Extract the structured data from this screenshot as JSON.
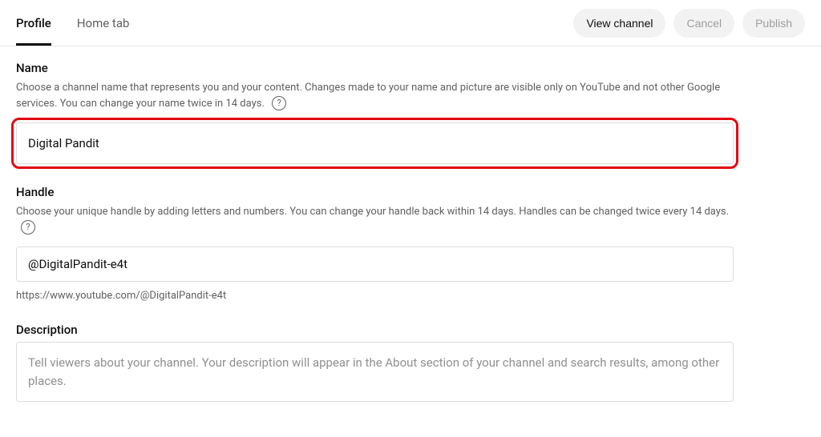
{
  "tabs": {
    "profile": "Profile",
    "home": "Home tab"
  },
  "actions": {
    "view": "View channel",
    "cancel": "Cancel",
    "publish": "Publish"
  },
  "name": {
    "title": "Name",
    "desc": "Choose a channel name that represents you and your content. Changes made to your name and picture are visible only on YouTube and not other Google services. You can change your name twice in 14 days.",
    "value": "Digital Pandit"
  },
  "handle": {
    "title": "Handle",
    "desc": "Choose your unique handle by adding letters and numbers. You can change your handle back within 14 days. Handles can be changed twice every 14 days.",
    "value": "@DigitalPandit-e4t",
    "url": "https://www.youtube.com/@DigitalPandit-e4t"
  },
  "description": {
    "title": "Description",
    "placeholder": "Tell viewers about your channel. Your description will appear in the About section of your channel and search results, among other places."
  },
  "help_glyph": "?"
}
